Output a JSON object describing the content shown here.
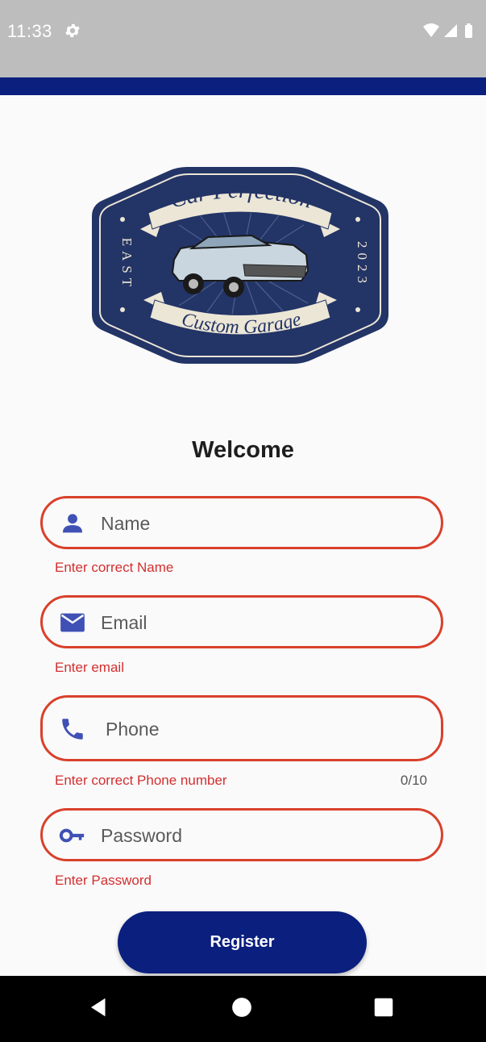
{
  "status_bar": {
    "time": "11:33",
    "icons": [
      "gear-icon",
      "wifi-icon",
      "signal-icon",
      "battery-icon"
    ]
  },
  "logo": {
    "top_text": "Car Perfection",
    "bottom_text": "Custom Garage",
    "left_text": "EAST",
    "right_text": "2023",
    "brand_color": "#233466",
    "ribbon_color": "#ece6d6"
  },
  "form": {
    "title": "Welcome",
    "fields": [
      {
        "icon": "person-icon",
        "placeholder": "Name",
        "error": "Enter correct Name"
      },
      {
        "icon": "email-icon",
        "placeholder": "Email",
        "error": "Enter email"
      },
      {
        "icon": "phone-icon",
        "placeholder": "Phone",
        "error": "Enter correct Phone number",
        "counter": "0/10"
      },
      {
        "icon": "key-icon",
        "placeholder": "Password",
        "error": "Enter Password"
      }
    ],
    "register_label": "Register"
  },
  "nav_bar": {
    "buttons": [
      "back-icon",
      "home-icon",
      "recents-icon"
    ]
  },
  "colors": {
    "primary": "#0a1f7e",
    "error": "#d9402b",
    "icon": "#3f51b5"
  }
}
